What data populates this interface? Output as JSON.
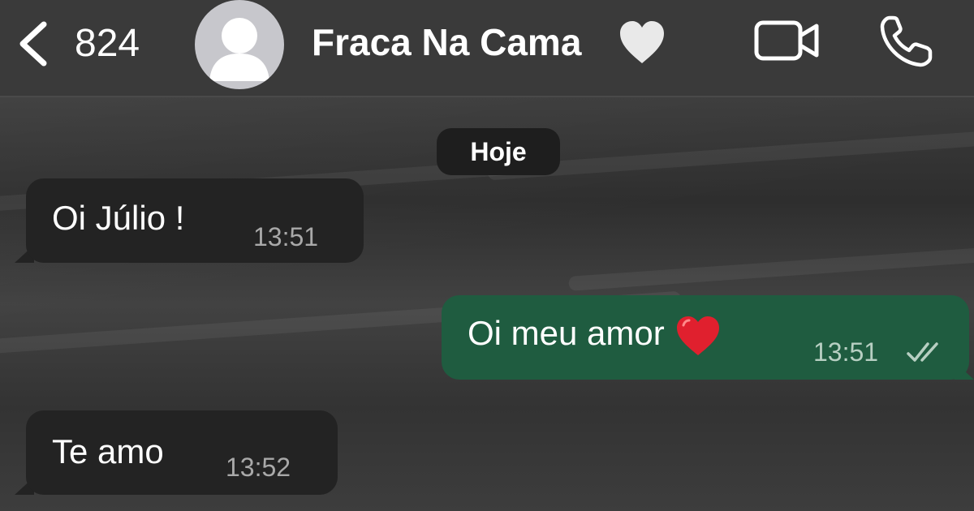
{
  "header": {
    "unread_count": "824",
    "contact_name": "Fraca Na Cama",
    "icons": {
      "back": "chevron-left-icon",
      "avatar": "default-avatar-icon",
      "name_emoji": "white-heart-icon",
      "video": "video-camera-icon",
      "phone": "phone-icon"
    }
  },
  "chat": {
    "date_separator": "Hoje",
    "messages": [
      {
        "direction": "incoming",
        "text": "Oi Júlio !",
        "time": "13:51"
      },
      {
        "direction": "outgoing",
        "text": "Oi meu amor",
        "emoji": "red-heart-icon",
        "time": "13:51",
        "status": "read-double-check-icon"
      },
      {
        "direction": "incoming",
        "text": "Te amo",
        "time": "13:52"
      }
    ]
  },
  "colors": {
    "header_bg": "#3a3a3a",
    "incoming_bubble": "#232323",
    "outgoing_bubble": "#1f5c40",
    "timestamp": "#a9a9a9",
    "red_heart": "#e0202e"
  }
}
